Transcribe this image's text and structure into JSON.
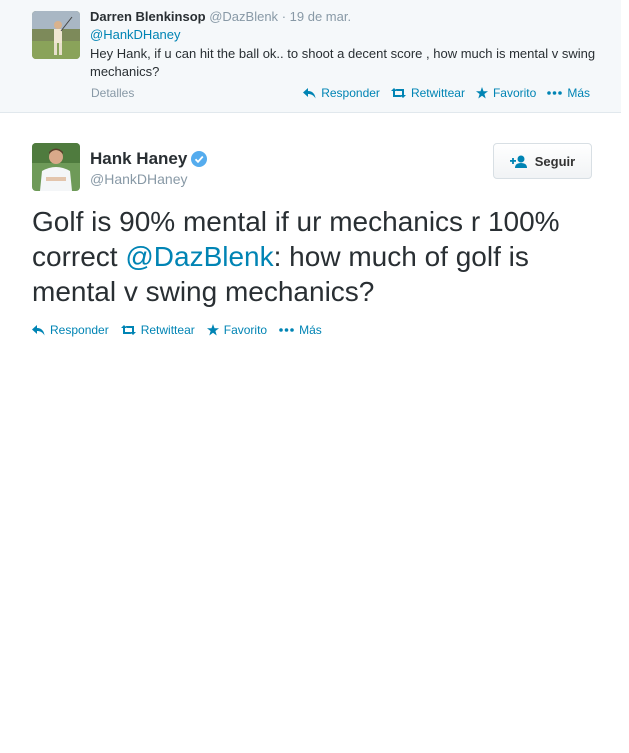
{
  "reply": {
    "name": "Darren Blenkinsop",
    "handle": "@DazBlenk",
    "separator": "·",
    "date": "19 de mar.",
    "mention": "@HankDHaney",
    "text": "Hey Hank, if u can hit the ball ok.. to shoot a decent score , how much is mental v swing mechanics?",
    "details_label": "Detalles",
    "actions": {
      "reply": "Responder",
      "retweet": "Retwittear",
      "favorite": "Favorito",
      "more": "Más"
    }
  },
  "main": {
    "name": "Hank Haney",
    "handle": "@HankDHaney",
    "follow_label": "Seguir",
    "text_part1": "Golf is 90% mental if ur mechanics r 100% correct ",
    "text_mention": "@DazBlenk",
    "text_part2": ": how much of golf is mental v swing mechanics?",
    "actions": {
      "reply": "Responder",
      "retweet": "Retwittear",
      "favorite": "Favorito",
      "more": "Más"
    }
  },
  "colors": {
    "link": "#0084b4",
    "muted": "#8899a6",
    "verified": "#55acee"
  }
}
